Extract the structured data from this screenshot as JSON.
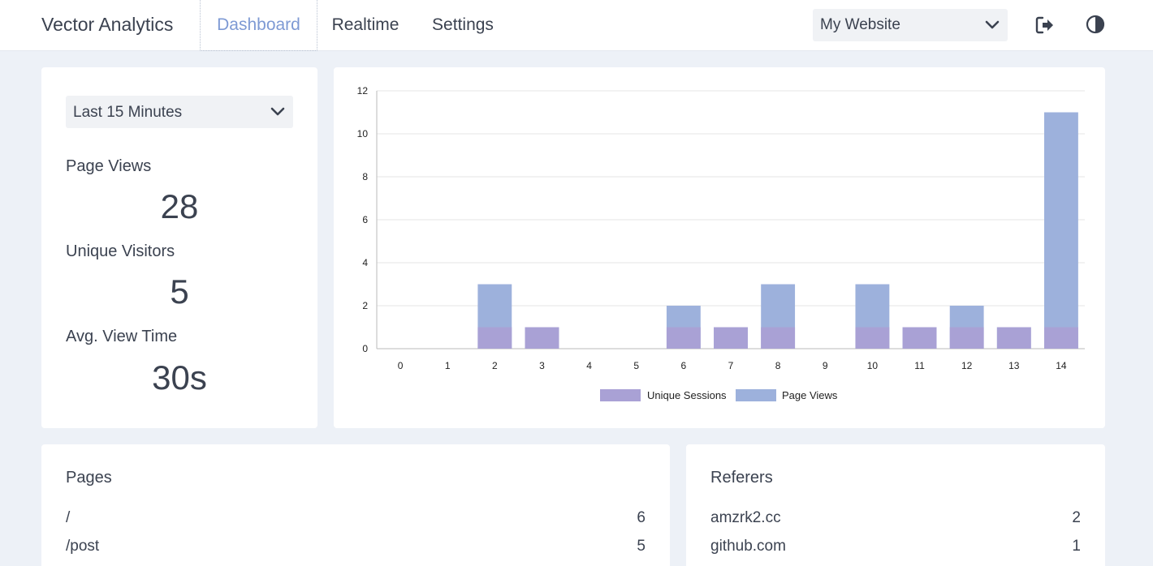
{
  "header": {
    "brand": "Vector Analytics",
    "tabs": [
      {
        "label": "Dashboard",
        "active": true
      },
      {
        "label": "Realtime",
        "active": false
      },
      {
        "label": "Settings",
        "active": false
      }
    ],
    "site_select": {
      "value": "My Website",
      "icon": "chevron-down-icon"
    },
    "logout_icon": "logout-icon",
    "theme_icon": "contrast-icon"
  },
  "stats": {
    "range_select": {
      "value": "Last 15 Minutes",
      "icon": "chevron-down-icon"
    },
    "page_views": {
      "label": "Page Views",
      "value": "28"
    },
    "unique_visitors": {
      "label": "Unique Visitors",
      "value": "5"
    },
    "avg_view_time": {
      "label": "Avg. View Time",
      "value": "30s"
    }
  },
  "chart_data": {
    "type": "bar",
    "stacked": true,
    "categories": [
      "0",
      "1",
      "2",
      "3",
      "4",
      "5",
      "6",
      "7",
      "8",
      "9",
      "10",
      "11",
      "12",
      "13",
      "14"
    ],
    "series": [
      {
        "name": "Unique Sessions",
        "color": "#a9a1d5",
        "values": [
          0,
          0,
          1,
          1,
          0,
          0,
          1,
          1,
          1,
          0,
          1,
          1,
          1,
          1,
          1
        ]
      },
      {
        "name": "Page Views",
        "color": "#9db1dc",
        "values": [
          0,
          0,
          3,
          1,
          0,
          0,
          2,
          1,
          3,
          0,
          3,
          1,
          2,
          1,
          11
        ]
      }
    ],
    "ylim": [
      0,
      12
    ],
    "yticks": [
      0,
      2,
      4,
      6,
      8,
      10,
      12
    ],
    "grid": true,
    "legend": "bottom"
  },
  "pages": {
    "title": "Pages",
    "rows": [
      {
        "name": "/",
        "count": "6"
      },
      {
        "name": "/post",
        "count": "5"
      }
    ]
  },
  "referrers": {
    "title": "Referers",
    "rows": [
      {
        "name": "amzrk2.cc",
        "count": "2"
      },
      {
        "name": "github.com",
        "count": "1"
      }
    ]
  }
}
